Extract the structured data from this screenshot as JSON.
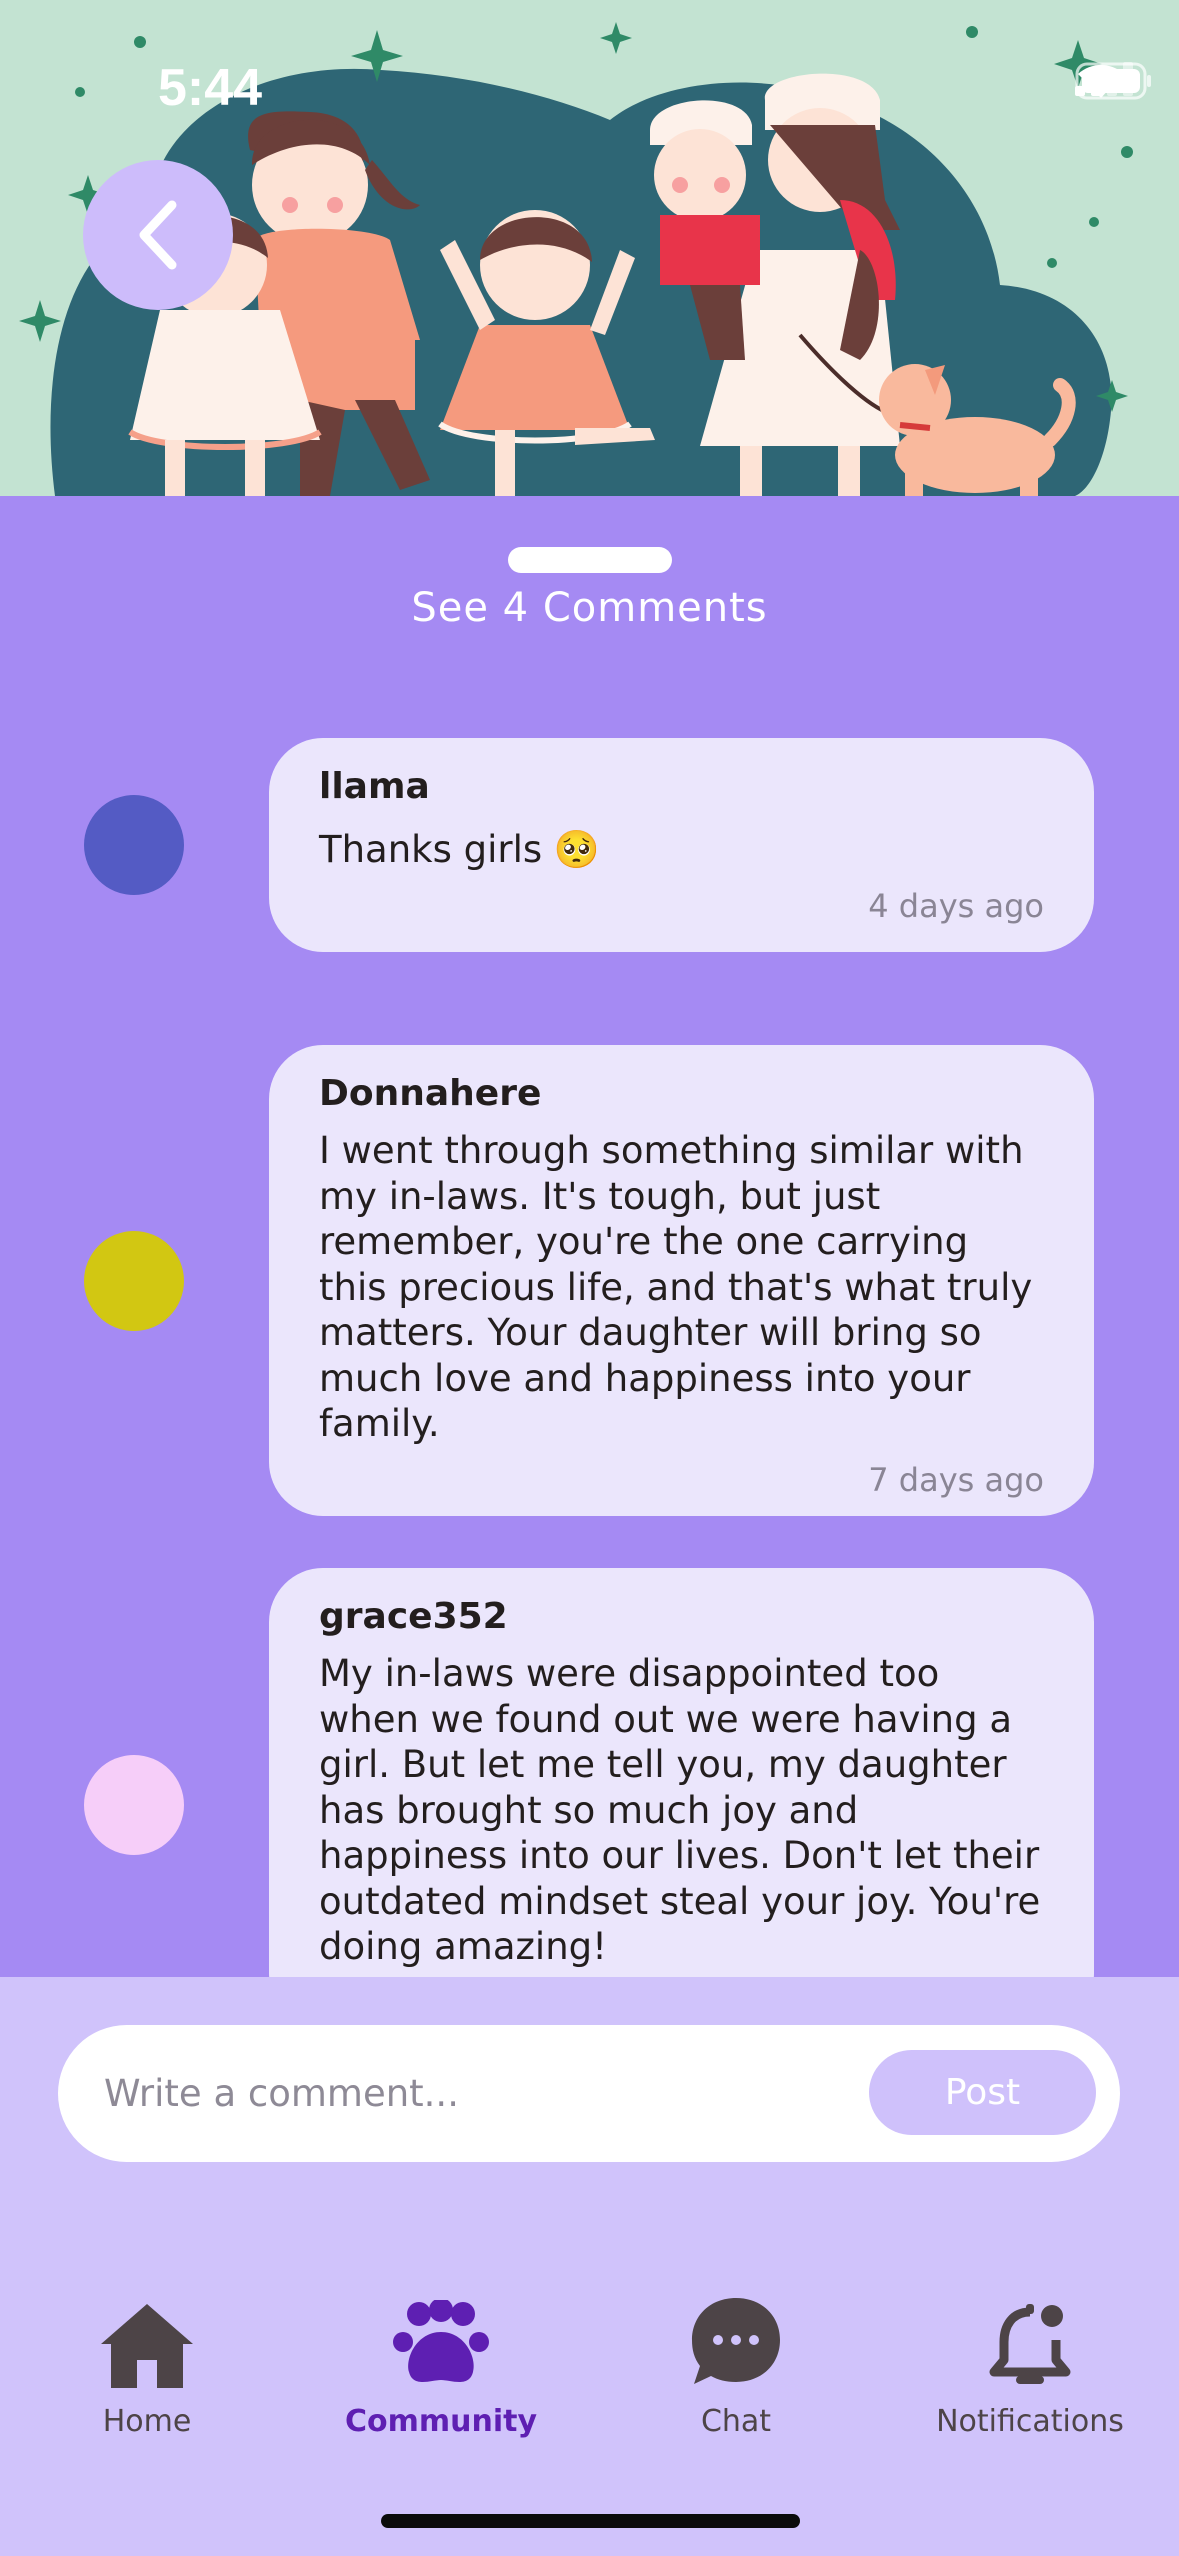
{
  "status_bar": {
    "time": "5:44"
  },
  "header": {
    "see_comments": "See 4 Comments"
  },
  "comments": [
    {
      "author": "llama",
      "text": "Thanks girls 🥺",
      "time": "4 days ago",
      "avatar_color": "#545bc4"
    },
    {
      "author": "Donnahere",
      "text": "I went through something similar with my in-laws. It's tough, but just remember, you're the one carrying this precious life, and that's what truly matters. Your daughter will bring so much love and happiness into your family.",
      "time": "7 days ago",
      "avatar_color": "#d2c712"
    },
    {
      "author": "grace352",
      "text": "My in-laws were disappointed too when we found out we were having a girl. But let me tell you, my daughter has brought so much joy and happiness into our lives. Don't let their outdated mindset steal your joy. You're doing amazing!",
      "avatar_color": "#f6cef9"
    }
  ],
  "composer": {
    "placeholder": "Write a comment...",
    "post_label": "Post"
  },
  "tabs": [
    {
      "label": "Home",
      "icon": "house-icon"
    },
    {
      "label": "Community",
      "icon": "paw-icon",
      "active": true
    },
    {
      "label": "Chat",
      "icon": "chat-bubble-icon"
    },
    {
      "label": "Notifications",
      "icon": "bell-icon"
    }
  ],
  "colors": {
    "sheet_background": "#a58af3",
    "bubble": "#ebe6fc",
    "accent": "#5e1fb2",
    "hero_background": "#c3e3d2"
  }
}
